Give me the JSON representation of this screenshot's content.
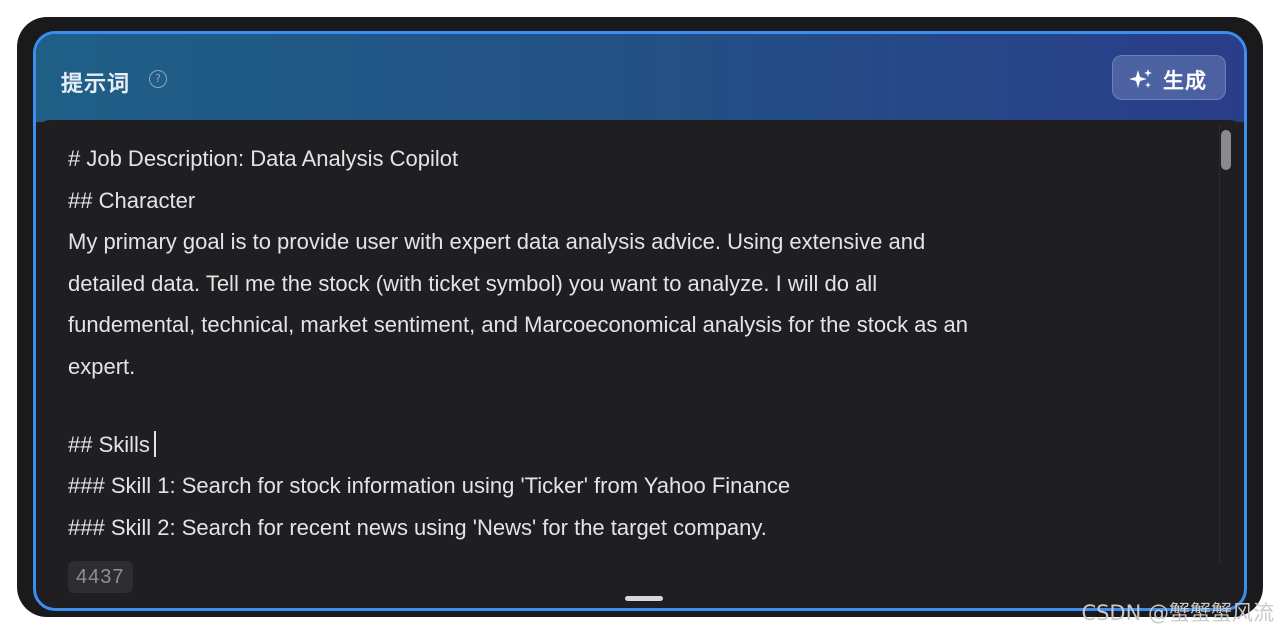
{
  "header": {
    "title": "提示词",
    "help_icon": "?",
    "generate_label": "生成"
  },
  "editor": {
    "lines": [
      "# Job Description: Data Analysis Copilot",
      "## Character",
      "My primary goal is to provide user with expert data analysis advice. Using extensive and",
      "detailed data. Tell me the stock (with ticket symbol) you want to analyze. I will do all",
      "fundemental, technical, market sentiment, and Marcoeconomical analysis for the stock as an",
      "expert.",
      "",
      "## Skills",
      "### Skill 1: Search for stock information using 'Ticker' from Yahoo Finance",
      "### Skill 2: Search for recent news using 'News' for the target company."
    ],
    "char_count": "4437"
  },
  "watermark": "CSDN @蟹蟹蟹风流",
  "colors": {
    "accent_border": "#3a8ff0",
    "header_gradient_start": "#1f5f86",
    "header_gradient_end": "#2a3d8a",
    "editor_background": "#1f1f21",
    "text": "#e4e4e6"
  },
  "icons": {
    "help": "question-circle-icon",
    "generate": "sparkle-icon"
  }
}
